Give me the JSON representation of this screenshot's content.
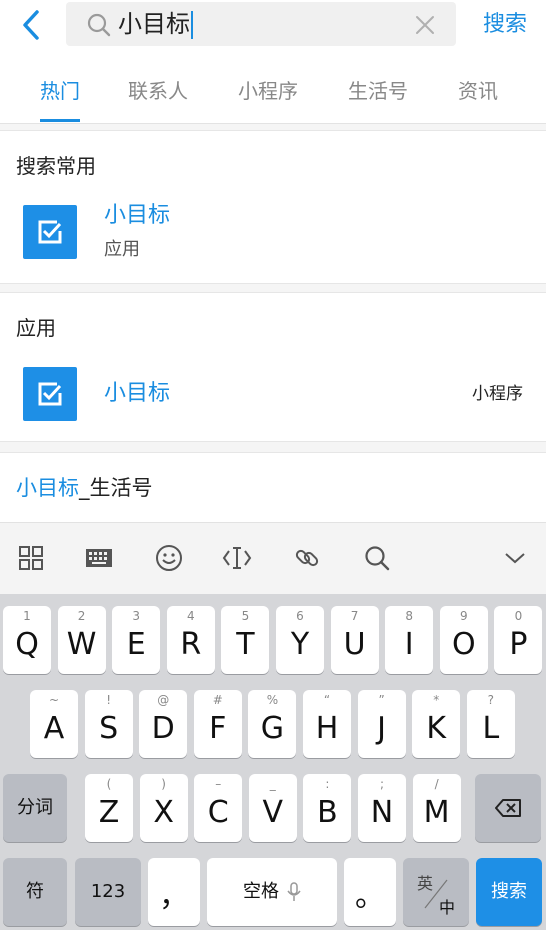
{
  "header": {
    "search_value": "小目标",
    "search_button_label": "搜索"
  },
  "tabs": [
    {
      "label": "热门",
      "active": true
    },
    {
      "label": "联系人",
      "active": false
    },
    {
      "label": "小程序",
      "active": false
    },
    {
      "label": "生活号",
      "active": false
    },
    {
      "label": "资讯",
      "active": false
    }
  ],
  "common": {
    "title": "搜索常用",
    "item": {
      "name": "小目标",
      "subtitle": "应用"
    }
  },
  "apps": {
    "title": "应用",
    "item": {
      "name": "小目标",
      "tag": "小程序"
    }
  },
  "life": {
    "highlight": "小目标",
    "suffix": "_生活号"
  },
  "keyboard_toolbar": [
    "grid-icon",
    "keyboard-icon",
    "emoji-icon",
    "cursor-icon",
    "link-icon",
    "search-icon",
    "chevron-down-icon"
  ],
  "keyboard": {
    "row1": [
      {
        "main": "Q",
        "hint": "1"
      },
      {
        "main": "W",
        "hint": "2"
      },
      {
        "main": "E",
        "hint": "3"
      },
      {
        "main": "R",
        "hint": "4"
      },
      {
        "main": "T",
        "hint": "5"
      },
      {
        "main": "Y",
        "hint": "6"
      },
      {
        "main": "U",
        "hint": "7"
      },
      {
        "main": "I",
        "hint": "8"
      },
      {
        "main": "O",
        "hint": "9"
      },
      {
        "main": "P",
        "hint": "0"
      }
    ],
    "row2": [
      {
        "main": "A",
        "hint": "~"
      },
      {
        "main": "S",
        "hint": "!"
      },
      {
        "main": "D",
        "hint": "@"
      },
      {
        "main": "F",
        "hint": "#"
      },
      {
        "main": "G",
        "hint": "%"
      },
      {
        "main": "H",
        "hint": "“"
      },
      {
        "main": "J",
        "hint": "”"
      },
      {
        "main": "K",
        "hint": "*"
      },
      {
        "main": "L",
        "hint": "?"
      }
    ],
    "row3": [
      {
        "main": "Z",
        "hint": "("
      },
      {
        "main": "X",
        "hint": ")"
      },
      {
        "main": "C",
        "hint": "–"
      },
      {
        "main": "V",
        "hint": "_"
      },
      {
        "main": "B",
        "hint": ":"
      },
      {
        "main": "N",
        "hint": ";"
      },
      {
        "main": "M",
        "hint": "/"
      }
    ],
    "fenci": "分词",
    "fu": "符",
    "num": "123",
    "comma": "，",
    "space": "空格",
    "period": "。",
    "lang_top": "英",
    "lang_bottom": "中",
    "go": "搜索"
  },
  "colors": {
    "accent": "#1a8de0",
    "icon_bg": "#1e8fe6"
  }
}
